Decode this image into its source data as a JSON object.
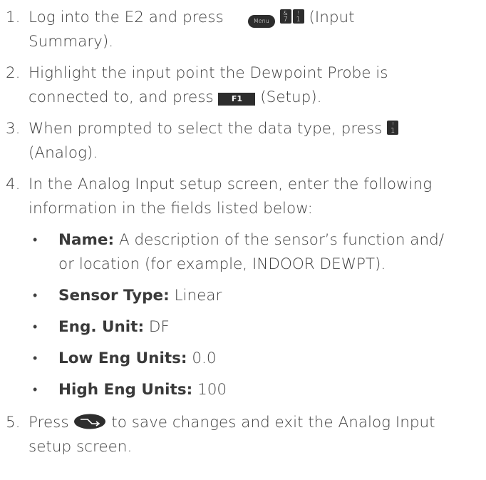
{
  "steps": [
    {
      "number": "1.",
      "line1_text1": "Log into the E2 and press",
      "keys": {
        "menu": "Menu",
        "k7_top": "&",
        "k7_bot": "7",
        "k1_top": "!",
        "k1_bot": "1"
      },
      "line1_text2": "(Input",
      "line2": "Summary)."
    },
    {
      "number": "2.",
      "line1": "Highlight the input point the Dewpoint Probe is",
      "line2_text1": "connected to, and press",
      "f1_key": "F1",
      "line2_text2": "(Setup)."
    },
    {
      "number": "3.",
      "line1": "When prompted to select the data type, press",
      "key_top": "!",
      "key_bot": "1",
      "line2": "(Analog)."
    },
    {
      "number": "4.",
      "line1": "In the Analog Input setup screen, enter the following",
      "line2": "information in the fields listed below:",
      "bullets": [
        {
          "label": "Name:",
          "line1": "A description of the sensor’s function and/",
          "line2": "or location (for example, INDOOR DEWPT)."
        },
        {
          "label": "Sensor Type:",
          "value": "Linear"
        },
        {
          "label": "Eng. Unit:",
          "value": "DF"
        },
        {
          "label": "Low Eng Units:",
          "value": "0.0"
        },
        {
          "label": "High Eng Units:",
          "value": "100"
        }
      ]
    },
    {
      "number": "5.",
      "line1_text1": "Press",
      "line1_text2": "to save changes and exit the Analog Input",
      "line2": "setup screen."
    }
  ],
  "icons": {
    "save_key": "save-arrow-key-icon"
  }
}
